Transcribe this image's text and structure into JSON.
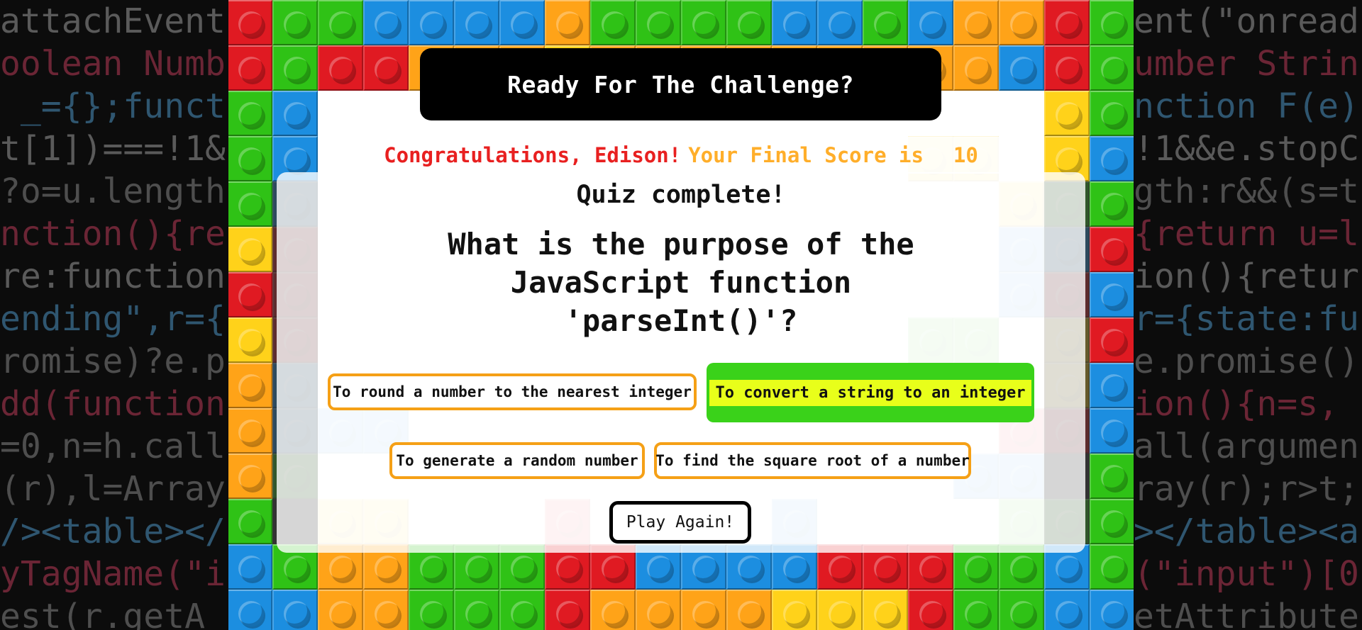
{
  "backdrop": {
    "left_lines": [
      "attachEvent",
      "oolean Numb",
      " _={};funct",
      "t[1])===!1&",
      "?o=u.length",
      "nction(){re",
      "re:function",
      "ending\",r={",
      "romise)?e.p",
      "dd(function",
      "=0,n=h.call",
      "(r),l=Array",
      "/><table></",
      "yTagName(\"i",
      "est(r.getA"
    ],
    "right_lines": [
      "ent(\"onread",
      "umber Strin",
      "nction F(e)",
      "!1&&e.stopC",
      "gth:r&&(s=t",
      "{return u=l",
      "ion(){retur",
      "r={state:fu",
      "e.promise()",
      "ion(){n=s,",
      "all(argumen",
      "ray(r);r>t;",
      "></table><a",
      "(\"input\")[0",
      "etAttribute"
    ]
  },
  "colors": {
    "red": "#e01a22",
    "green": "#2fc216",
    "blue": "#1c8ee0",
    "yellow": "#ffd21a",
    "orange": "#ffa318",
    "answer_border": "#f5a016",
    "correct_bg": "#3ad21a",
    "correct_highlight": "#e8ff1a",
    "congrats_text": "#e82020",
    "score_text": "#ffae2a"
  },
  "bricks": {
    "top_row_1": [
      "red",
      "green",
      "green",
      "blue",
      "blue",
      "blue",
      "blue",
      "orange",
      "green",
      "green",
      "green",
      "green",
      "blue",
      "blue",
      "green",
      "blue",
      "orange",
      "orange",
      "red",
      "green"
    ],
    "top_row_2": [
      "red",
      "green",
      "red",
      "red",
      "orange",
      "orange",
      "orange",
      "yellow",
      "orange",
      "orange",
      "orange",
      "orange",
      "orange",
      "orange",
      "orange",
      "orange",
      "orange",
      "blue",
      "red",
      "green"
    ],
    "left_col": [
      "green",
      "green",
      "green",
      "yellow",
      "red",
      "yellow",
      "orange",
      "orange",
      "orange",
      "green"
    ],
    "left_col_2": [
      "blue",
      "blue",
      "blue",
      "red",
      "red",
      "red",
      "blue",
      "blue",
      "blue",
      "green"
    ],
    "right_col_2": [
      "yellow",
      "yellow",
      "yellow",
      "blue",
      "blue",
      "yellow",
      "blue",
      "blue",
      "red",
      "blue"
    ],
    "right_col": [
      "green",
      "blue",
      "green",
      "red",
      "blue",
      "red",
      "blue",
      "blue",
      "green",
      "green"
    ],
    "bottom_row_1": [
      "blue",
      "green",
      "orange",
      "orange",
      "green",
      "green",
      "green",
      "red",
      "red",
      "blue",
      "blue",
      "blue",
      "blue",
      "red",
      "red",
      "red",
      "green",
      "green",
      "blue",
      "green"
    ],
    "bottom_row_2": [
      "blue",
      "blue",
      "orange",
      "orange",
      "green",
      "green",
      "green",
      "red",
      "orange",
      "orange",
      "orange",
      "orange",
      "yellow",
      "yellow",
      "yellow",
      "red",
      "green",
      "green",
      "blue",
      "blue"
    ],
    "faded": [
      {
        "c": 1,
        "r": 4,
        "color": "blue"
      },
      {
        "c": 1,
        "r": 5,
        "color": "red"
      },
      {
        "c": 1,
        "r": 6,
        "color": "red"
      },
      {
        "c": 1,
        "r": 7,
        "color": "red"
      },
      {
        "c": 1,
        "r": 8,
        "color": "blue"
      },
      {
        "c": 1,
        "r": 9,
        "color": "blue"
      },
      {
        "c": 2,
        "r": 9,
        "color": "blue"
      },
      {
        "c": 3,
        "r": 9,
        "color": "blue"
      },
      {
        "c": 1,
        "r": 10,
        "color": "green"
      },
      {
        "c": 2,
        "r": 11,
        "color": "yellow"
      },
      {
        "c": 3,
        "r": 11,
        "color": "yellow"
      },
      {
        "c": 7,
        "r": 11,
        "color": "red"
      },
      {
        "c": 12,
        "r": 11,
        "color": "blue"
      },
      {
        "c": 15,
        "r": 7,
        "color": "green"
      },
      {
        "c": 16,
        "r": 7,
        "color": "green"
      },
      {
        "c": 15,
        "r": 8,
        "color": "green"
      },
      {
        "c": 16,
        "r": 8,
        "color": "green"
      },
      {
        "c": 17,
        "r": 5,
        "color": "blue"
      },
      {
        "c": 18,
        "r": 5,
        "color": "blue"
      },
      {
        "c": 17,
        "r": 6,
        "color": "blue"
      },
      {
        "c": 18,
        "r": 6,
        "color": "red"
      },
      {
        "c": 18,
        "r": 7,
        "color": "yellow"
      },
      {
        "c": 18,
        "r": 8,
        "color": "yellow"
      },
      {
        "c": 17,
        "r": 9,
        "color": "red"
      },
      {
        "c": 18,
        "r": 9,
        "color": "red"
      },
      {
        "c": 17,
        "r": 10,
        "color": "blue"
      },
      {
        "c": 16,
        "r": 10,
        "color": "blue"
      },
      {
        "c": 17,
        "r": 11,
        "color": "green"
      },
      {
        "c": 18,
        "r": 11,
        "color": "green"
      },
      {
        "c": 16,
        "r": 3,
        "color": "yellow"
      },
      {
        "c": 17,
        "r": 4,
        "color": "yellow"
      },
      {
        "c": 18,
        "r": 4,
        "color": "green"
      },
      {
        "c": 15,
        "r": 3,
        "color": "yellow"
      }
    ]
  },
  "header": {
    "title": "Ready For The Challenge?"
  },
  "score": {
    "congrats": "Congratulations, Edison!",
    "label": "Your Final Score is",
    "value": "10"
  },
  "quiz": {
    "status": "Quiz complete!",
    "question": "What is the purpose of the JavaScript function 'parseInt()'?",
    "answers": [
      "To round a number to the nearest integer",
      "To convert a string to an integer",
      "To generate a random number",
      "To find the square root of a number"
    ],
    "correct_answer": "To convert a string to an integer",
    "play_again_label": "Play Again!"
  }
}
